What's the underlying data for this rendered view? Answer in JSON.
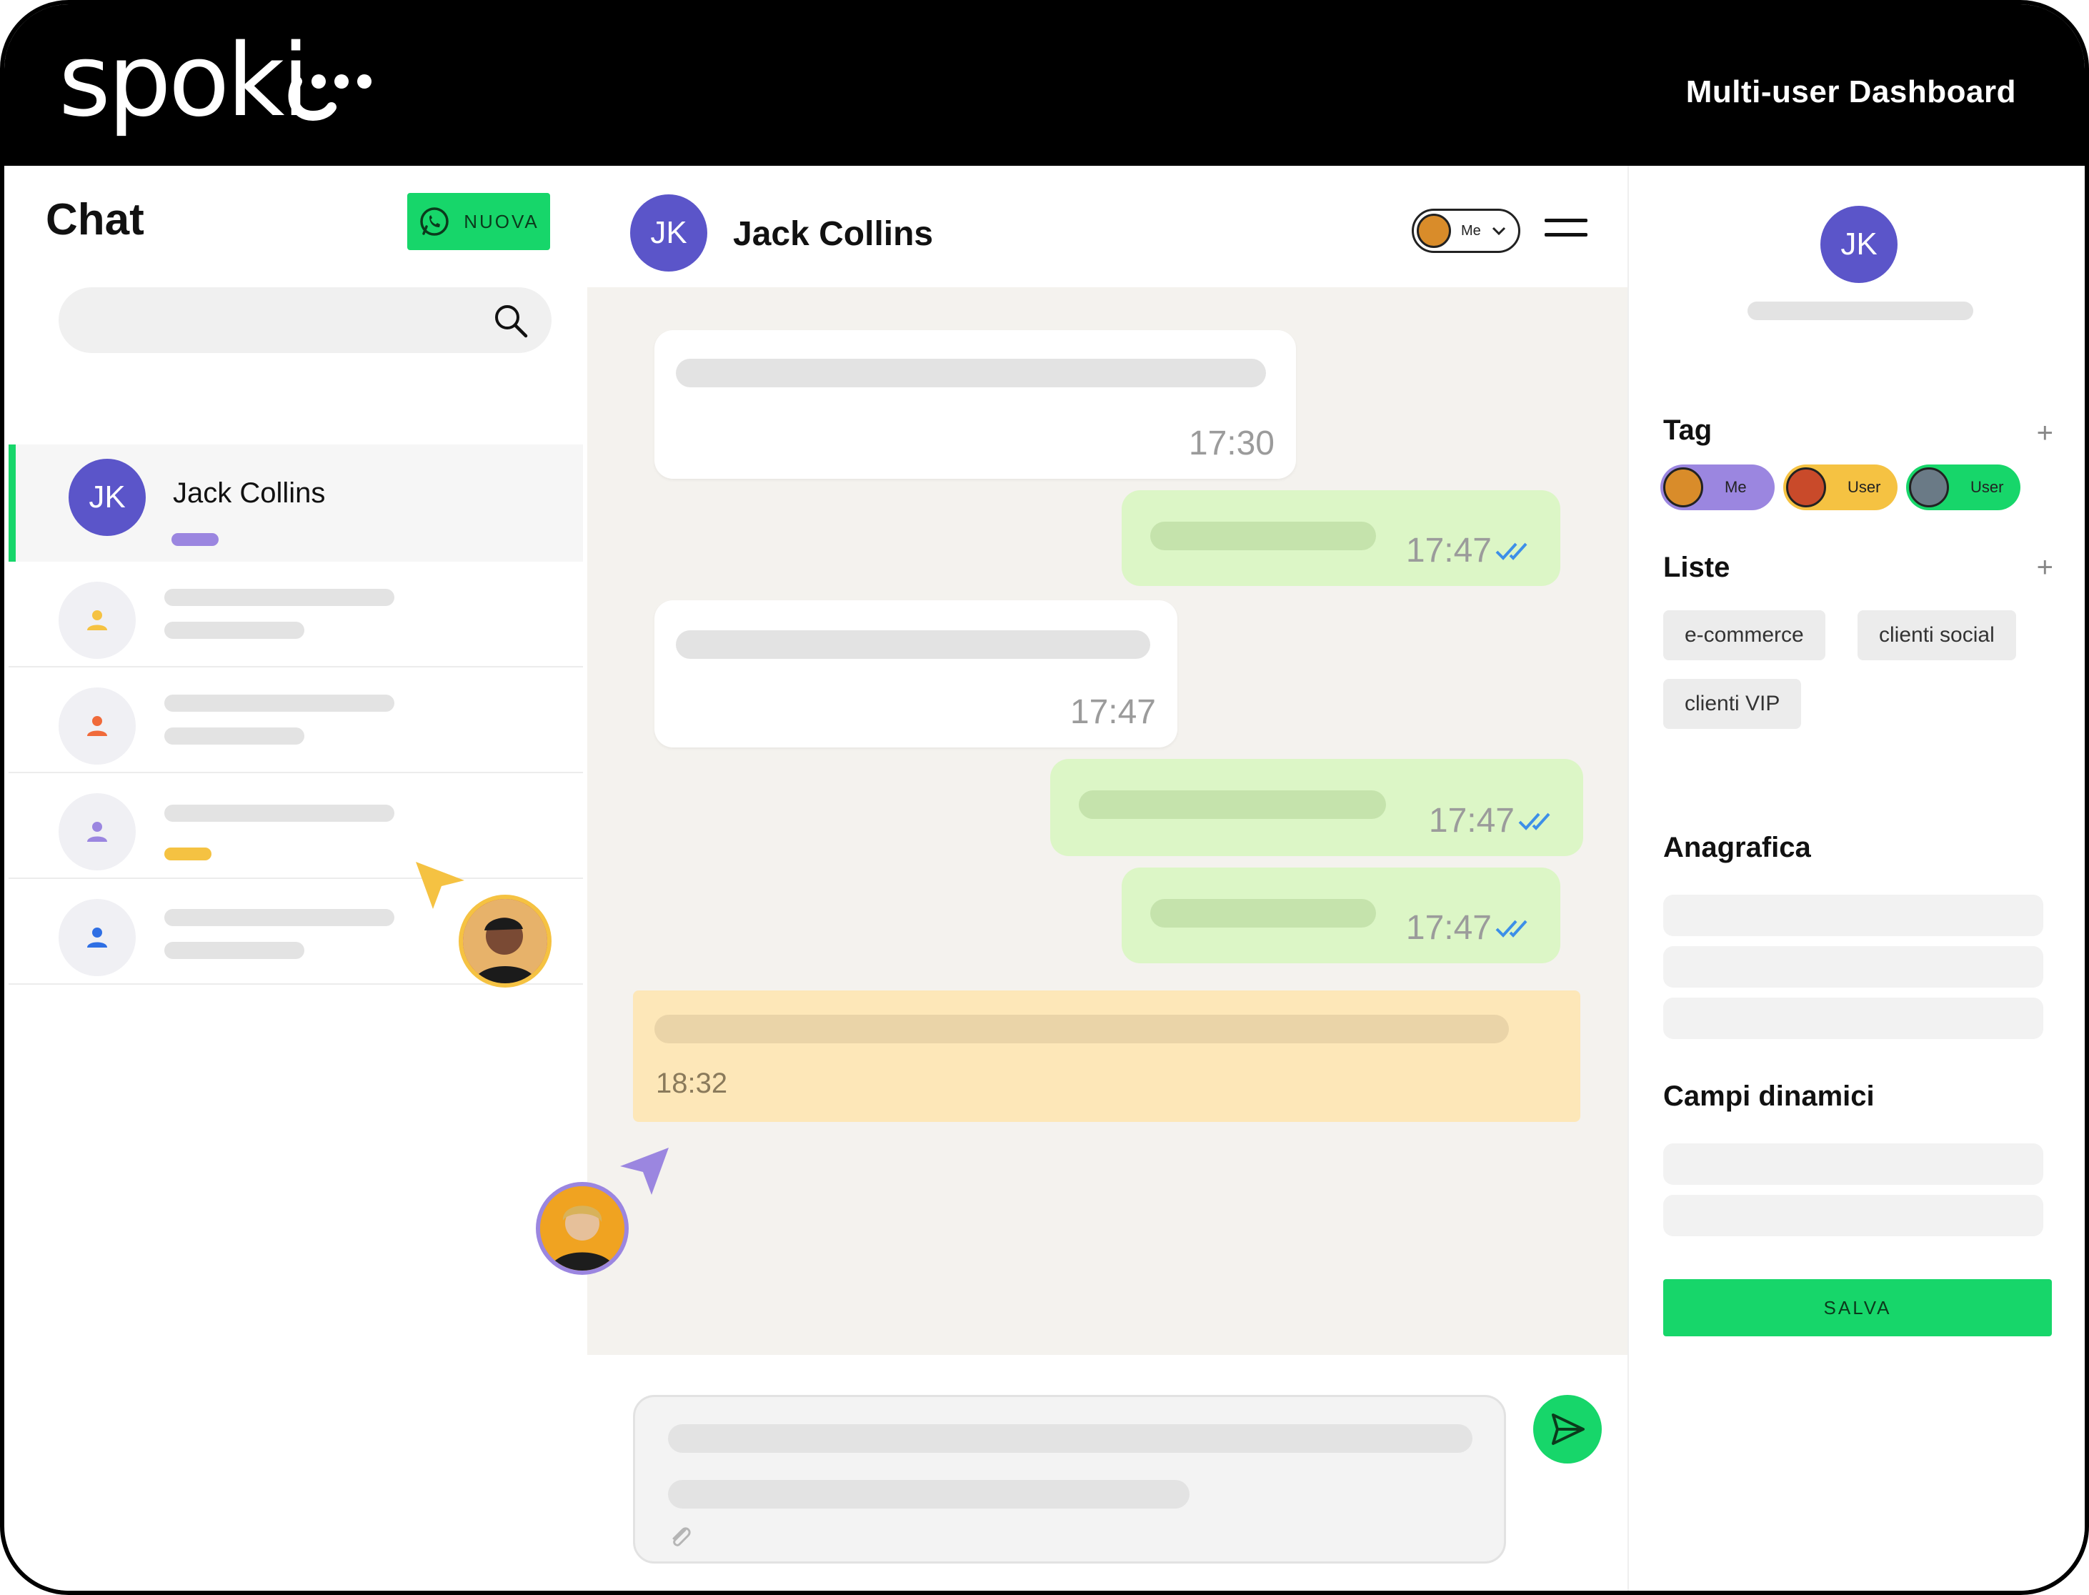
{
  "header": {
    "logo_text": "spoki",
    "product_title": "Multi-user Dashboard"
  },
  "sidebar": {
    "title": "Chat",
    "new_button_label": "NUOVA",
    "search": {
      "placeholder": ""
    },
    "conversations": [
      {
        "initials": "JK",
        "name": "Jack Collins",
        "tag_color": "#9b86e0",
        "avatar_color": "#5b55c9"
      },
      {
        "icon": "person-icon",
        "icon_color": "#f5c242"
      },
      {
        "icon": "person-icon",
        "icon_color": "#f06a3a"
      },
      {
        "icon": "person-icon",
        "icon_color": "#9b86e0",
        "tag_color": "#f5c242"
      },
      {
        "icon": "person-icon",
        "icon_color": "#2f6fe4"
      }
    ]
  },
  "chat": {
    "contact_initials": "JK",
    "contact_name": "Jack Collins",
    "assignee_label": "Me",
    "messages": [
      {
        "direction": "in",
        "time": "17:30"
      },
      {
        "direction": "out",
        "time": "17:47",
        "status": "read"
      },
      {
        "direction": "in",
        "time": "17:47"
      },
      {
        "direction": "out",
        "time": "17:47",
        "status": "read"
      },
      {
        "direction": "out",
        "time": "17:47",
        "status": "read"
      }
    ],
    "note": {
      "time": "18:32"
    },
    "composer": {
      "placeholder": ""
    }
  },
  "details": {
    "initials": "JK",
    "tag_section_title": "Tag",
    "tags": [
      {
        "label": "Me",
        "color": "#9b86e0"
      },
      {
        "label": "User",
        "color": "#f5c242"
      },
      {
        "label": "User",
        "color": "#17d66a"
      }
    ],
    "lists_section_title": "Liste",
    "lists": [
      "e-commerce",
      "clienti social",
      "clienti VIP"
    ],
    "registry_section_title": "Anagrafica",
    "dynamic_section_title": "Campi dinamici",
    "save_label": "SALVA"
  },
  "colors": {
    "brand_green": "#17d66a",
    "avatar_purple": "#5b55c9",
    "chat_background": "#f4f2ee",
    "outgoing_bubble": "#dcf6c6",
    "note_background": "#fde7b8",
    "read_ticks": "#3d8fe8"
  }
}
